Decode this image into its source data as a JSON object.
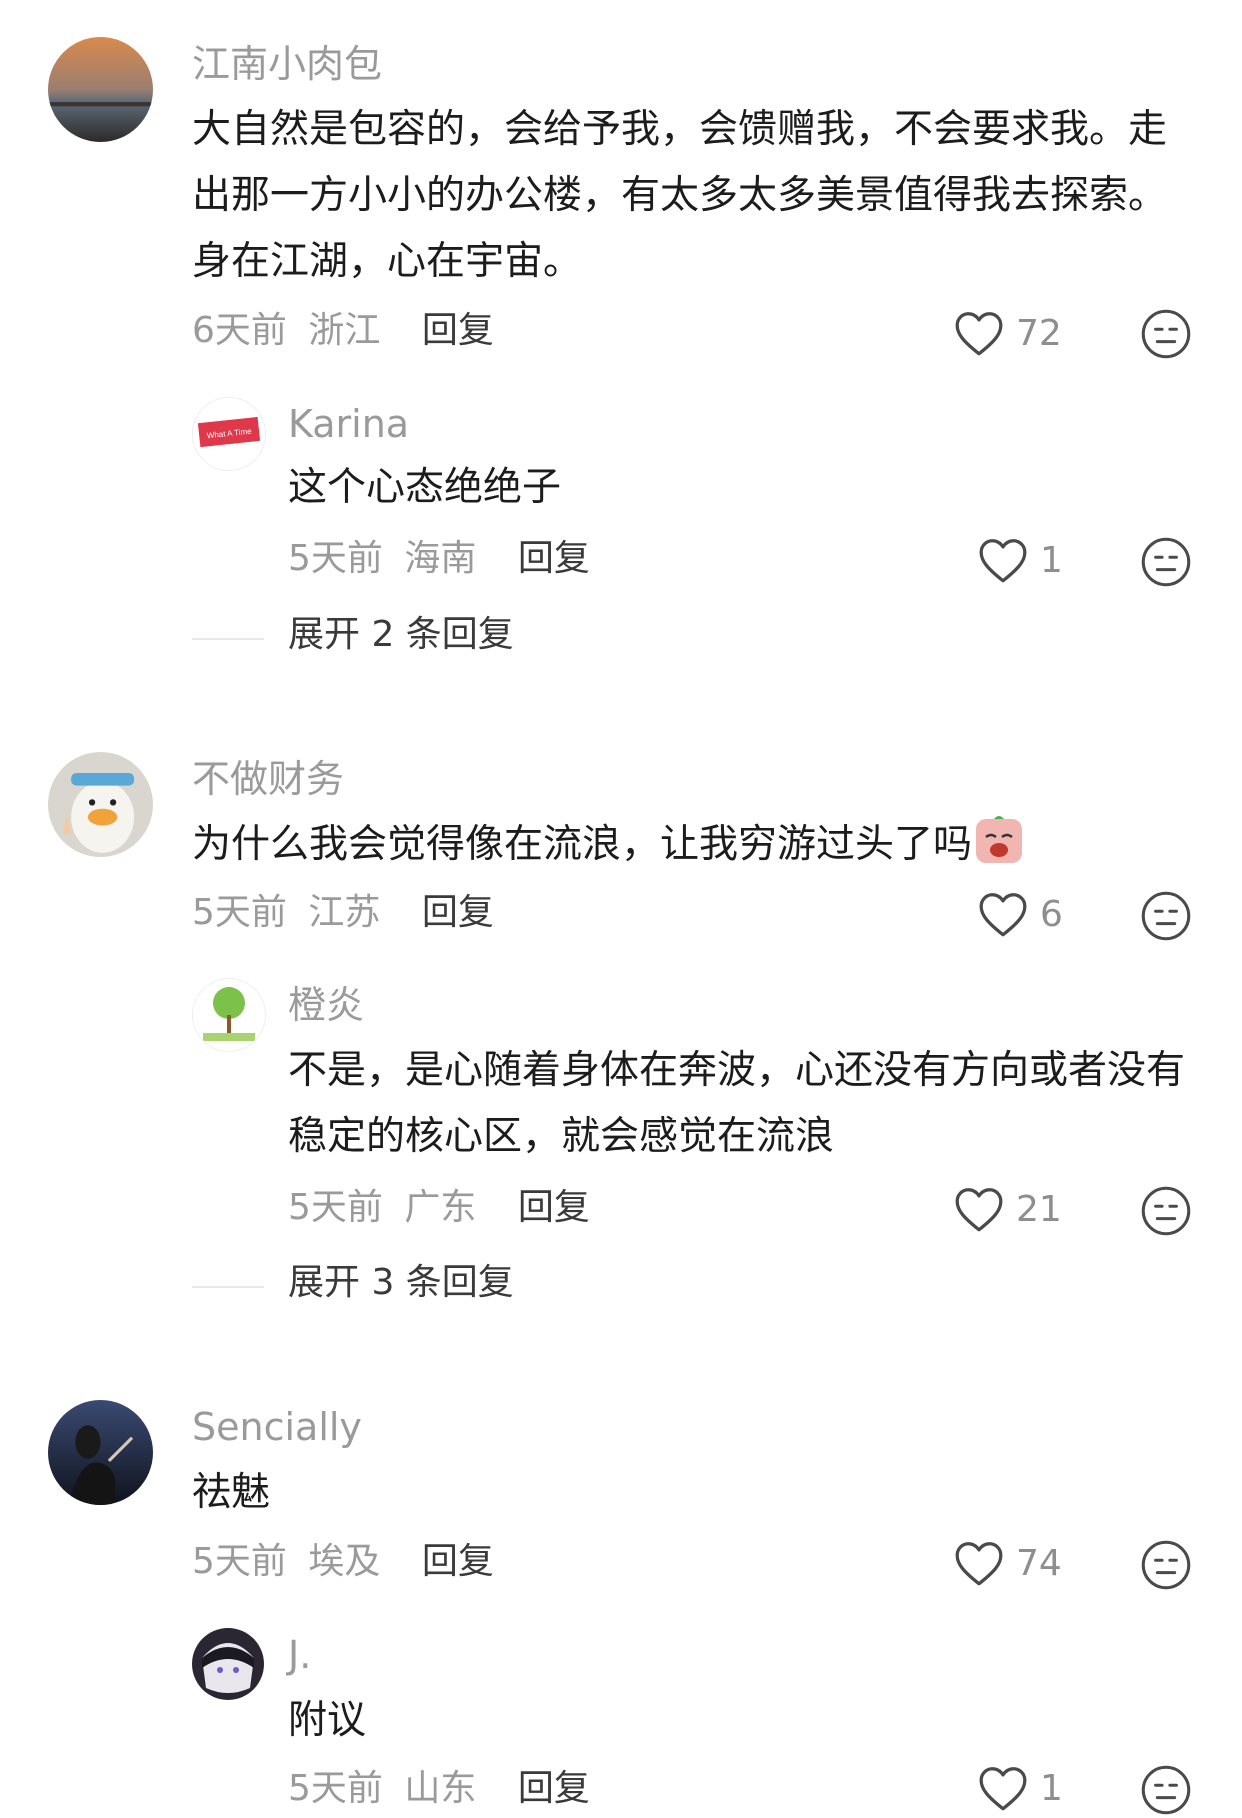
{
  "icons": {
    "like": "heart-outline-icon",
    "dislike": "neutral-face-icon"
  },
  "comments": [
    {
      "author": "江南小肉包",
      "text": "大自然是包容的，会给予我，会馈赠我，不会要求我。走出那一方小小的办公楼，有太多太多美景值得我去探索。身在江湖，心在宇宙。",
      "time": "6天前",
      "location": "浙江",
      "reply": "回复",
      "likes": "72"
    },
    {
      "author": "Karina",
      "avatar_text": "What A Time",
      "text": "这个心态绝绝子",
      "time": "5天前",
      "location": "海南",
      "reply": "回复",
      "likes": "1"
    },
    {
      "author": "不做财务",
      "text": "为什么我会觉得像在流浪，让我穷游过头了吗",
      "time": "5天前",
      "location": "江苏",
      "reply": "回复",
      "likes": "6"
    },
    {
      "author": "橙炎",
      "text": "不是，是心随着身体在奔波，心还没有方向或者没有稳定的核心区，就会感觉在流浪",
      "time": "5天前",
      "location": "广东",
      "reply": "回复",
      "likes": "21"
    },
    {
      "author": "Sencially",
      "text": "祛魅",
      "time": "5天前",
      "location": "埃及",
      "reply": "回复",
      "likes": "74"
    },
    {
      "author": "J.",
      "text": "附议",
      "time": "5天前",
      "location": "山东",
      "reply": "回复",
      "likes": "1"
    }
  ],
  "expand": [
    {
      "label": "展开 2 条回复"
    },
    {
      "label": "展开 3 条回复"
    }
  ]
}
